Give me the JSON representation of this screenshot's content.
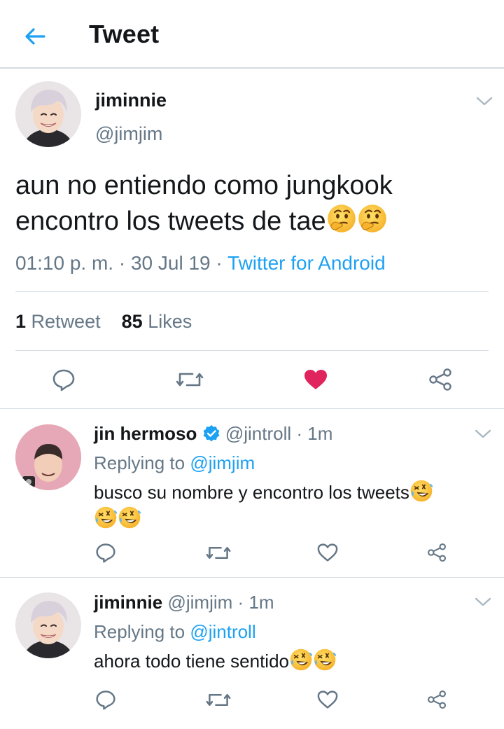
{
  "header": {
    "title": "Tweet"
  },
  "tweet": {
    "author_name": "jiminnie",
    "author_handle": "@jimjim",
    "text": "aun no entiendo como jungkook encontro los tweets de tae",
    "text_emojis": [
      "thinking-face",
      "thinking-face"
    ],
    "time": "01:10 p. m.",
    "date": "30 Jul 19",
    "source": "Twitter for Android",
    "retweets_count": "1",
    "retweets_label": "Retweet",
    "likes_count": "85",
    "likes_label": "Likes",
    "liked": true
  },
  "replies": [
    {
      "name": "jin hermoso",
      "verified": true,
      "handle": "@jintroll",
      "age": "1m",
      "replying_label": "Replying to",
      "replying_to": "@jimjim",
      "text": "busco su nombre y encontro los tweets",
      "text_emojis": [
        "rolling-laughing-face",
        "rolling-laughing-face",
        "rolling-laughing-face"
      ]
    },
    {
      "name": "jiminnie",
      "verified": false,
      "handle": "@jimjim",
      "age": "1m",
      "replying_label": "Replying to",
      "replying_to": "@jintroll",
      "text": "ahora todo tiene sentido",
      "text_emojis": [
        "rolling-laughing-face",
        "rolling-laughing-face"
      ]
    }
  ],
  "separator": "·",
  "colors": {
    "accent": "#1da1f2",
    "like": "#e0245e",
    "secondary_text": "#657786",
    "icon": "#657786"
  }
}
